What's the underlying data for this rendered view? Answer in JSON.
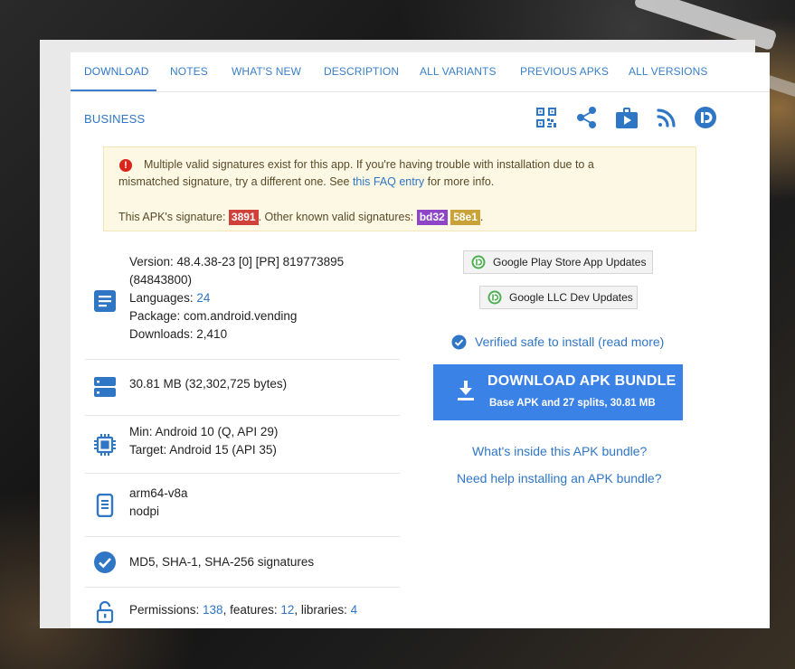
{
  "tabs": [
    "DOWNLOAD",
    "NOTES",
    "WHAT'S NEW",
    "DESCRIPTION",
    "ALL VARIANTS",
    "PREVIOUS APKS",
    "ALL VERSIONS"
  ],
  "section_title": "BUSINESS",
  "toolbar_icons": [
    "qr-code-icon",
    "share-icon",
    "play-store-icon",
    "rss-icon",
    "apkmirror-icon"
  ],
  "warning": {
    "line1": "Multiple valid signatures exist for this app. If you're having trouble with installation due to a",
    "line2_prefix": "mismatched signature, try a different one. See ",
    "faq_link": "this FAQ entry",
    "line2_suffix": " for more info.",
    "sig_prefix": "This APK's signature: ",
    "sig_main": "3891",
    "sig_mid": ". Other known valid signatures: ",
    "sig_alt1": "bd32",
    "sig_alt2": "58e1",
    "sig_end": ".",
    "colors": {
      "sig_main": "#d0413c",
      "sig_alt1": "#8e45c7",
      "sig_alt2": "#c9a33a"
    }
  },
  "details": {
    "version": "Version: 48.4.38-23 [0] [PR] 819773895",
    "version_code": "(84843800)",
    "languages_label": "Languages: ",
    "languages_count": "24",
    "package": "Package: com.android.vending",
    "downloads": "Downloads: 2,410",
    "size": "30.81 MB (32,302,725 bytes)",
    "min_sdk": "Min: Android 10 (Q, API 29)",
    "target_sdk": "Target: Android 15 (API 35)",
    "arch": "arm64-v8a",
    "dpi": "nodpi",
    "signatures_link": "MD5, SHA-1, SHA-256 signatures",
    "permissions_label": "Permissions: ",
    "permissions_count": "138",
    "features_label": ", features: ",
    "features_count": "12",
    "libraries_label": ", libraries: ",
    "libraries_count": "4"
  },
  "subscribe": {
    "play_updates": "Google Play Store App Updates",
    "dev_updates": "Google LLC Dev Updates"
  },
  "verified_text": "Verified safe to install (read more)",
  "download_button": {
    "title": "DOWNLOAD APK BUNDLE",
    "subtitle": "Base APK and 27 splits, 30.81 MB"
  },
  "help_links": {
    "inside": "What's inside this APK bundle?",
    "help": "Need help installing an APK bundle?"
  },
  "colors": {
    "accent": "#2f76c5",
    "button": "#3b82e6",
    "warning_bg": "#fcf8e3"
  }
}
